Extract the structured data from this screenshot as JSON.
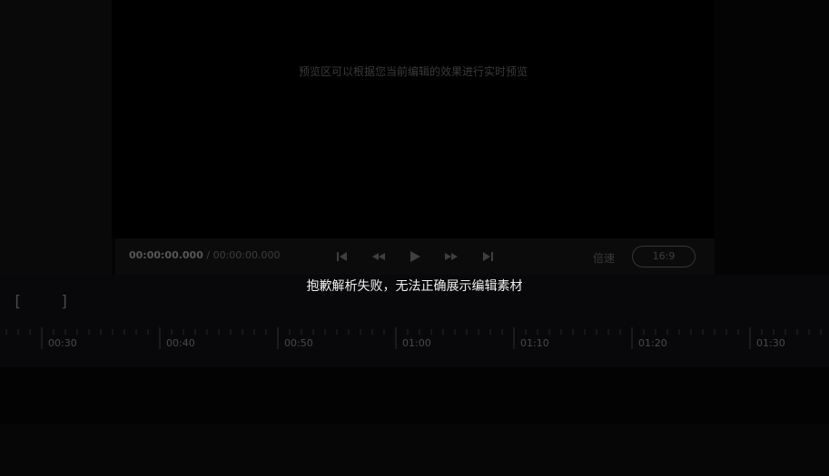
{
  "preview": {
    "hint": "预览区可以根据您当前编辑的效果进行实时预览"
  },
  "player": {
    "current_time": "00:00:00.000",
    "separator": " / ",
    "total_time": "00:00:00.000",
    "speed_label": "倍速",
    "aspect_ratio": "16:9",
    "controls": [
      "skip-to-start-icon",
      "rewind-icon",
      "play-icon",
      "fast-forward-icon",
      "skip-to-end-icon"
    ]
  },
  "timeline": {
    "in_marker": "[",
    "out_marker": "]",
    "error_message": "抱歉解析失败，无法正确展示编辑素材",
    "ticks": [
      "00:30",
      "00:40",
      "00:50",
      "01:00",
      "01:10",
      "01:20",
      "01:30"
    ]
  },
  "colors": {
    "background": "#040404",
    "control_icon": "#3f3f3f",
    "error_text": "#f0f0f0"
  }
}
